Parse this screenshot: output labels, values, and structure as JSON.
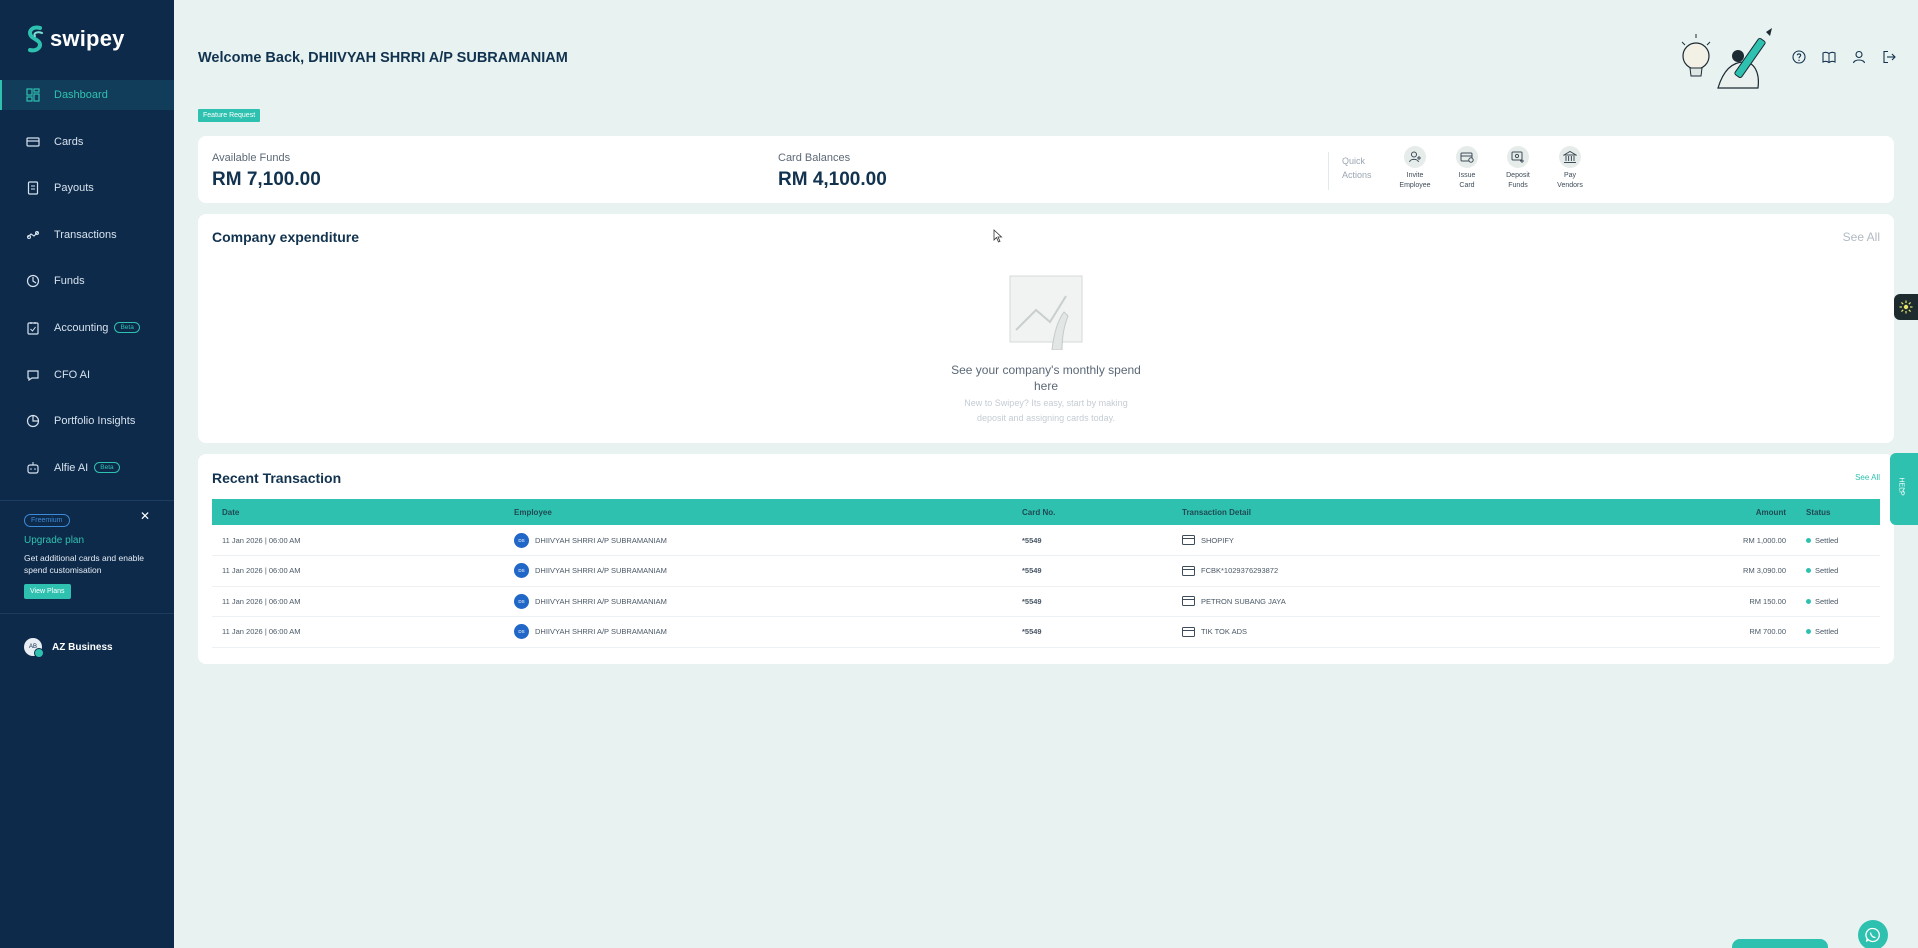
{
  "app": {
    "brand": "swipey",
    "welcome": "Welcome Back, DHIIVYAH SHRRI A/P SUBRAMANIAM",
    "feature_request": "Feature Request"
  },
  "sidebar": {
    "items": [
      {
        "label": "Dashboard",
        "icon": "dashboard-icon",
        "active": true
      },
      {
        "label": "Cards",
        "icon": "card-icon"
      },
      {
        "label": "Payouts",
        "icon": "payouts-icon"
      },
      {
        "label": "Transactions",
        "icon": "transactions-icon"
      },
      {
        "label": "Funds",
        "icon": "funds-icon"
      },
      {
        "label": "Accounting",
        "icon": "accounting-icon",
        "badge": "Beta"
      },
      {
        "label": "CFO AI",
        "icon": "chat-icon"
      },
      {
        "label": "Portfolio Insights",
        "icon": "pie-icon"
      },
      {
        "label": "Alfie AI",
        "icon": "robot-icon",
        "badge": "Beta"
      }
    ],
    "upgrade": {
      "badge": "Freemium",
      "title": "Upgrade plan",
      "description": "Get additional cards and enable spend customisation",
      "button": "View Plans"
    },
    "business": {
      "avatar": "AB",
      "name": "AZ Business"
    }
  },
  "funds": {
    "available_label": "Available Funds",
    "available_value": "RM 7,100.00",
    "card_balance_label": "Card Balances",
    "card_balance_value": "RM 4,100.00",
    "quick_actions_label": "Quick Actions",
    "quick_actions": [
      {
        "line1": "Invite",
        "line2": "Employee",
        "icon": "invite-employee-icon"
      },
      {
        "line1": "Issue",
        "line2": "Card",
        "icon": "issue-card-icon"
      },
      {
        "line1": "Deposit",
        "line2": "Funds",
        "icon": "deposit-funds-icon"
      },
      {
        "line1": "Pay",
        "line2": "Vendors",
        "icon": "bank-icon"
      }
    ]
  },
  "expenditure": {
    "title": "Company expenditure",
    "see_all": "See All",
    "empty_title": "See your company's monthly spend here",
    "empty_sub": "New to Swipey? Its easy, start by making deposit and assigning cards today."
  },
  "transactions": {
    "title": "Recent Transaction",
    "see_all": "See All",
    "columns": [
      "Date",
      "Employee",
      "Card No.",
      "Transaction Detail",
      "Amount",
      "Status"
    ],
    "rows": [
      {
        "date": "11 Jan 2026 | 06:00 AM",
        "avatar": "DS",
        "employee": "DHIIVYAH SHRRI A/P SUBRAMANIAM",
        "card": "*5549",
        "detail": "SHOPIFY",
        "amount": "RM 1,000.00",
        "status": "Settled"
      },
      {
        "date": "11 Jan 2026 | 06:00 AM",
        "avatar": "DS",
        "employee": "DHIIVYAH SHRRI A/P SUBRAMANIAM",
        "card": "*5549",
        "detail": "FCBK*1029376293872",
        "amount": "RM 3,090.00",
        "status": "Settled"
      },
      {
        "date": "11 Jan 2026 | 06:00 AM",
        "avatar": "DS",
        "employee": "DHIIVYAH SHRRI A/P SUBRAMANIAM",
        "card": "*5549",
        "detail": "PETRON SUBANG JAYA",
        "amount": "RM 150.00",
        "status": "Settled"
      },
      {
        "date": "11 Jan 2026 | 06:00 AM",
        "avatar": "DS",
        "employee": "DHIIVYAH SHRRI A/P SUBRAMANIAM",
        "card": "*5549",
        "detail": "TIK TOK ADS",
        "amount": "RM 700.00",
        "status": "Settled"
      }
    ]
  },
  "help_tab": "HELP",
  "colors": {
    "sidebar": "#0e2a4a",
    "accent": "#2fc1b0",
    "background": "#e8f2f0"
  }
}
